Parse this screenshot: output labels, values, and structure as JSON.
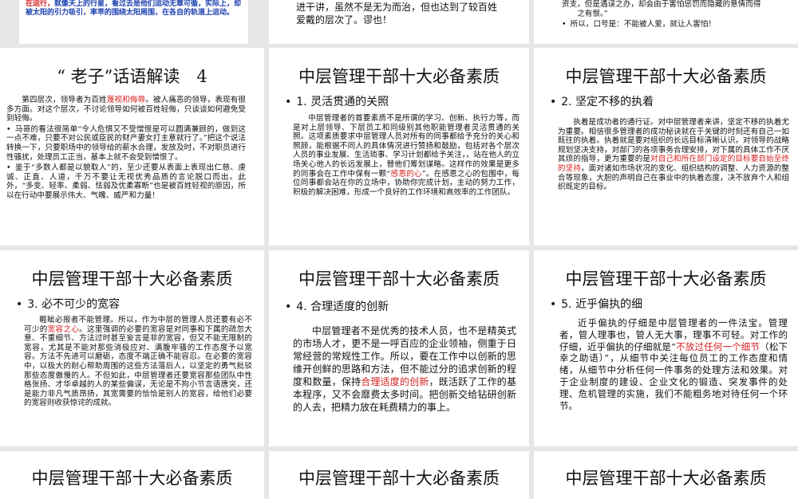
{
  "top_row": {
    "s1_text_red": "在运行，",
    "s1_text": "就像天上的行星，看过去是他们运动无章可循，实际上，却被太阳的引力吸引，率乖的围绕太阳周围，在各自的轨道上运动。",
    "s2_line1": "进干讲，虽然不是无为而治，但也达到了较百姓",
    "s2_line2": "爱戴的层次了。谬也！",
    "s3_line1": "资支，但是遇误之办，却会由于害怕惩罚而隐藏的意情而得",
    "s3_line2": "之有恨。”",
    "s3_bullet": "所以，口号是：不能被人爱，就让人害怕！"
  },
  "slides": [
    {
      "title": "“ 老子”话语解读　4",
      "paras": [
        {
          "pre": "第四层次，领导者为百姓",
          "hl": "蔑视和侮辱",
          "post": "。被人痛恶的领导，表现有很多方面。对这个层次，不讨论领导如何被百姓轻侮，只谈谈如何避免受到轻侮。"
        },
        {
          "pre": "马哥的看法很简单“令人危惧又不受憎恨是可以圆满兼顾的，做到这一点不难，只要不对公民或臣民的财产妻女打主意就行了。”把这个说法转换一下，只要职场中的领导给的薪水合理，发放及时，不对职员进行性骚扰，处理员工正当，基本上就不会受到憎恨了。",
          "hl": "",
          "post": ""
        },
        {
          "pre": "鉴于“多数人都是以貌取人”的，至少还要从表面上表现出仁慈、虔诚、正直、人道，千万不要让无视优秀品质的言论脱口而出。此外，“多变、轻率、柔弱、怯弱及优柔寡断”也是被百姓轻视的原因，所以在行动中要展示伟大、气魄、威严和力量！",
          "hl": "",
          "post": ""
        }
      ]
    },
    {
      "title": "中层管理干部十大必备素质",
      "bullet": "1. 灵活贯通的关照",
      "pre": "中层管理者的首要素质不是所谓的学习、创新、执行力等，而是对上层领导、下层员工和同级别其他职能管理者灵活贯通的关照。这项素质要求中层管理人员对所有的同事都给予充分的关心和照顾，能根据不同人的具体情况进行赞扬和鼓励，包括对各个层次人员的事业发展、生活琐事、学习计划都给予关注，，站在他人的立场关心他人的长远发展上，替他们筹划谋略。这样作的效果是更多的同事会在工作中保有一颗“",
      "hl": "感恩的心",
      "post": "”。在感恩之心的包围中，每位同事都会站在你的立场中，协助你完成计划，主动的努力工作，积极的解决困难，形成一个良好的工作环境和高效率的工作团队。"
    },
    {
      "title": "中层管理干部十大必备素质",
      "bullet": "2. 坚定不移的执着",
      "pre": "执着是成功者的通行证。对中层管理者来讲，坚定不移的执着尤为重要。相信很多管理者的成功秘诀就在于关键的时刻还有自己一如既往的执着。执着就是要对组织的长远目标清晰认识，对领导的战略规划坚决支持，对部门的各项事务合理安排，对下属的具体工作不厌其烦的指导，更为重要的是",
      "hl": "对自己和所在部门设定的目标要自始至终的坚持",
      "post": "，面对诸如市场状况的变化、组织结构的调整、人力资源的整合等现象，大胆的声明自己在事业中的执着态度，决不放弃个人和组织既定的目标。"
    },
    {
      "title": "中层管理干部十大必备素质",
      "bullet": "3. 必不可少的宽容",
      "pre": "睚眦必报者不能管理。所以，作为中层的管理人员还要有必不可少的",
      "hl": "宽容之心",
      "post": "。这里强调的必要的宽容是对同事和下属的疏忽大意、不重细节、方法过时甚至妄言是非的宽容，但又不能无限制的宽容，尤其是不能对那些消极应对、满腹牢骚的工作态度予以宽容。方法不先进可以磨砺，态度不端正确不能容忍。在必要的宽容中，以极大的耐心帮助周围的这些方法落后人，以坚定的勇气批驳那些态度傲慢的人。不但如此，中层管理者还要宽容那些团队中性格张扬、才华卓越的人的某些偏误，无论是不拘小节言语唐突，还是能力非凡气质昂扬，其宽需要的恰恰是别人的宽容，给他们必要的宽容则收获惊诧的成就。"
    },
    {
      "title": "中层管理干部十大必备素质",
      "bullet": "4. 合理适度的创新",
      "pre": "中层管理者不是优秀的技术人员，也不是精英式的市场人才，更不是一呼百应的企业领袖，侧重于日常经营的常规性工作。所以，要在工作中以创新的思维开创鲜的思路和方法，但不能过分的追求创新的程度和数量，保持",
      "hl": "合理适度的创新",
      "post": "，既活跃了工作的基本程序，又不会靡费太多时间。把创新交给钻研创新的人去，把精力放在耗费精力的事上。"
    },
    {
      "title": "中层管理干部十大必备素质",
      "bullet": "5. 近乎偏执的细",
      "pre": "近乎偏执的仔细是中层管理者的一件法宝。管理者，管人理事也，管人无大事，理事不可轻。对工作的仔细，近乎偏执的仔细就是“",
      "hl": "不放过任何一个细节",
      "post": "（松下幸之助语）”，从细节中关注每位员工的工作态度和情绪，从细节中分析任何一件事务的处理方法和效果。对于企业制度的建设、企业文化的锻造、突发事件的处理、危机管理的实施，我们不能粗务地对待任何一个环节。"
    }
  ],
  "bottom_row": [
    {
      "title": "中层管理干部十大必备素质"
    },
    {
      "title": "中层管理干部十大必备素质"
    },
    {
      "title": "中层管理干部十大必备素质"
    }
  ]
}
